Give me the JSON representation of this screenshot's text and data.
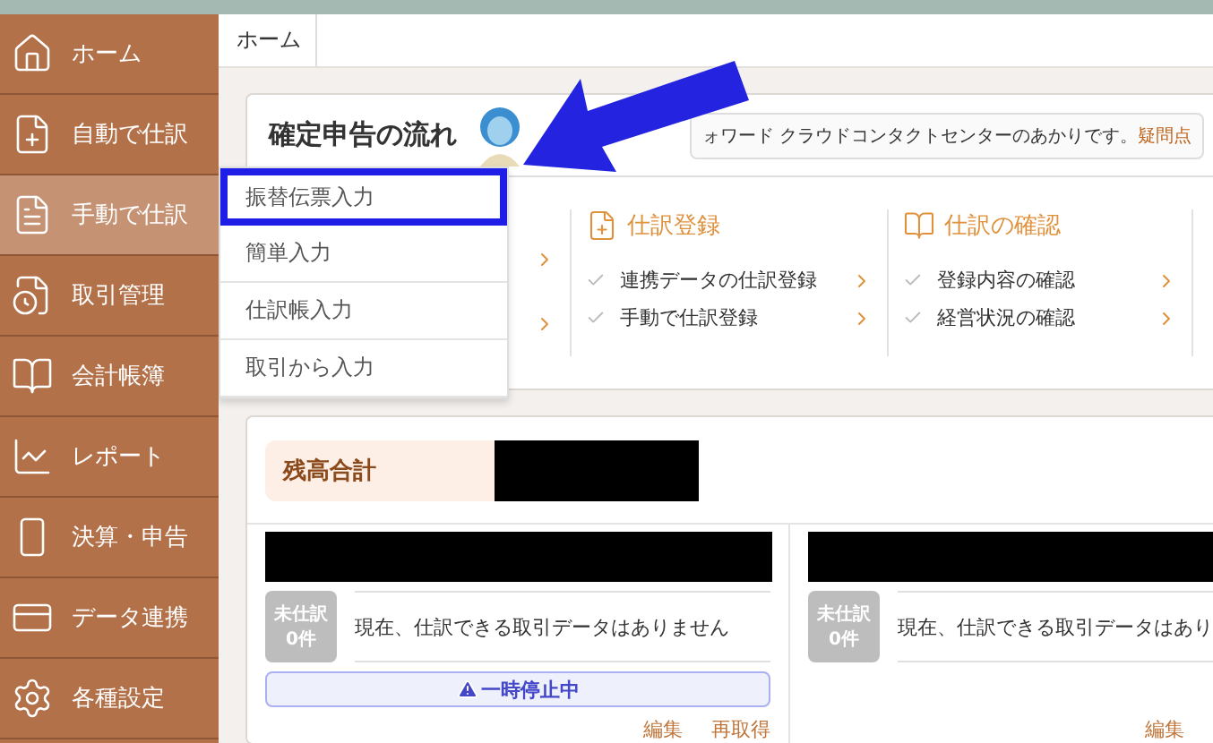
{
  "sidebar": {
    "items": [
      {
        "label": "ホーム",
        "selected": false
      },
      {
        "label": "自動で仕訳",
        "selected": false
      },
      {
        "label": "手動で仕訳",
        "selected": true
      },
      {
        "label": "取引管理",
        "selected": false
      },
      {
        "label": "会計帳簿",
        "selected": false
      },
      {
        "label": "レポート",
        "selected": false
      },
      {
        "label": "決算・申告",
        "selected": false
      },
      {
        "label": "データ連携",
        "selected": false
      },
      {
        "label": "各種設定",
        "selected": false
      }
    ]
  },
  "breadcrumb": [
    "ホーム"
  ],
  "flow_card": {
    "title": "確定申告の流れ",
    "bubble": {
      "text": "ォワード クラウドコンタクトセンターのあかりです。",
      "link": "疑問点"
    },
    "columns": [
      {
        "title": "仕訳登録",
        "items": [
          "連携データの仕訳登録",
          "手動で仕訳登録"
        ]
      },
      {
        "title": "仕訳の確認",
        "items": [
          "登録内容の確認",
          "経営状況の確認"
        ]
      }
    ]
  },
  "dropdown": {
    "items": [
      {
        "label": "振替伝票入力",
        "highlighted": true
      },
      {
        "label": "簡単入力",
        "highlighted": false
      },
      {
        "label": "仕訳帳入力",
        "highlighted": false
      },
      {
        "label": "取引から入力",
        "highlighted": false
      }
    ]
  },
  "balance_card": {
    "label": "残高合計",
    "accounts": [
      {
        "badge_title": "未仕訳",
        "badge_count": "0件",
        "message": "現在、仕訳できる取引データはありません",
        "notice": "一時停止中",
        "links": [
          "編集",
          "再取得"
        ]
      },
      {
        "badge_title": "未仕訳",
        "badge_count": "0件",
        "message": "現在、仕訳できる取引データはあり",
        "links": [
          "編集"
        ]
      }
    ]
  }
}
